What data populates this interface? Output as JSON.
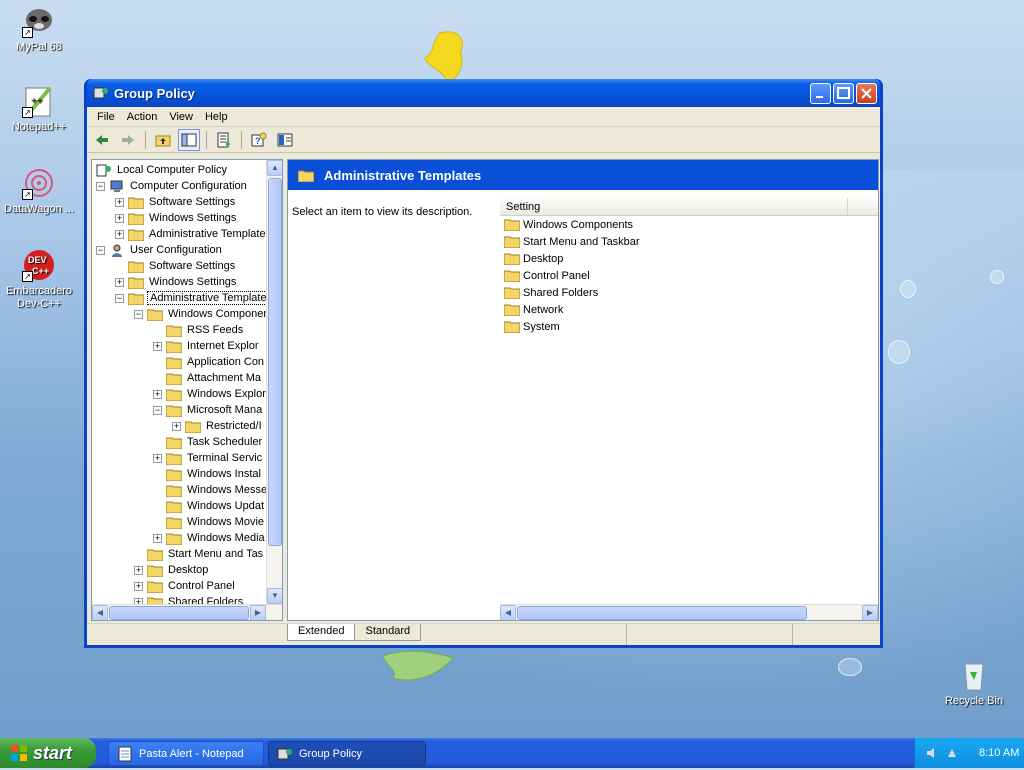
{
  "desktop": {
    "icons": [
      {
        "label": "MyPal 68"
      },
      {
        "label": "Notepad++"
      },
      {
        "label": "DataWagon ..."
      },
      {
        "label": "Embarcadero Dev-C++"
      },
      {
        "label": "Recycle Bin"
      }
    ]
  },
  "window": {
    "title": "Group Policy",
    "menu": [
      "File",
      "Action",
      "View",
      "Help"
    ]
  },
  "tree": {
    "items": [
      {
        "label": "Local Computer Policy"
      },
      {
        "label": "Computer Configuration"
      },
      {
        "label": "Software Settings"
      },
      {
        "label": "Windows Settings"
      },
      {
        "label": "Administrative Template"
      },
      {
        "label": "User Configuration"
      },
      {
        "label": "Software Settings"
      },
      {
        "label": "Windows Settings"
      },
      {
        "label": "Administrative Templates"
      },
      {
        "label": "Windows Componen"
      },
      {
        "label": "RSS Feeds"
      },
      {
        "label": "Internet Explor"
      },
      {
        "label": "Application Con"
      },
      {
        "label": "Attachment Ma"
      },
      {
        "label": "Windows Explor"
      },
      {
        "label": "Microsoft Mana"
      },
      {
        "label": "Restricted/I"
      },
      {
        "label": "Task Scheduler"
      },
      {
        "label": "Terminal Servic"
      },
      {
        "label": "Windows Instal"
      },
      {
        "label": "Windows Messe"
      },
      {
        "label": "Windows Updat"
      },
      {
        "label": "Windows Movie"
      },
      {
        "label": "Windows Media"
      },
      {
        "label": "Start Menu and Tas"
      },
      {
        "label": "Desktop"
      },
      {
        "label": "Control Panel"
      },
      {
        "label": "Shared Folders"
      }
    ]
  },
  "details": {
    "banner_title": "Administrative Templates",
    "description_prompt": "Select an item to view its description.",
    "column_header": "Setting",
    "items": [
      "Windows Components",
      "Start Menu and Taskbar",
      "Desktop",
      "Control Panel",
      "Shared Folders",
      "Network",
      "System"
    ]
  },
  "view_tabs": {
    "extended": "Extended",
    "standard": "Standard"
  },
  "taskbar": {
    "start_label": "start",
    "tasks": [
      "Pasta Alert - Notepad",
      "Group Policy"
    ],
    "clock": "8:10 AM"
  },
  "colors": {
    "titlebar_blue": "#0453d8",
    "banner_blue": "#0a4fd8",
    "folder_yellow": "#f5d565",
    "start_green": "#3a9b38"
  }
}
